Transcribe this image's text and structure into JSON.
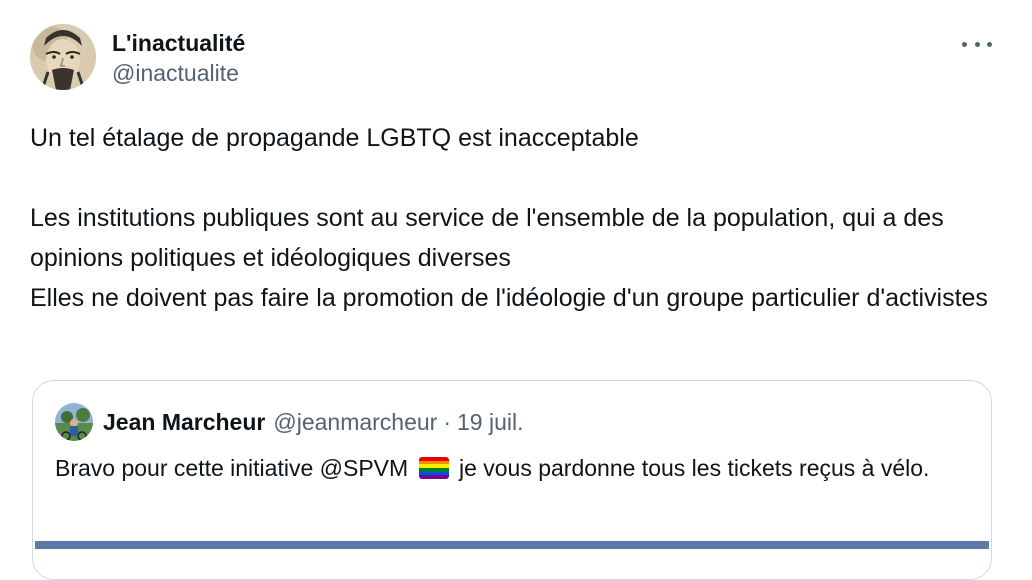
{
  "tweet": {
    "display_name": "L'inactualité",
    "handle": "@inactualite",
    "paragraphs": [
      "Un tel étalage de propagande LGBTQ est inacceptable",
      "Les institutions publiques sont au service de l'ensemble de la population, qui a des opinions politiques et idéologiques diverses",
      "Elles ne doivent pas faire la promotion de l'idéologie d'un groupe particulier d'activistes"
    ]
  },
  "quote": {
    "display_name": "Jean Marcheur",
    "handle": "@jeanmarcheur",
    "separator": "·",
    "date": "19 juil.",
    "text_before_flag": "Bravo pour cette initiative @SPVM",
    "text_after_flag": "je vous pardonne tous les tickets reçus à vélo."
  },
  "icons": {
    "more": "more-horizontal-icon",
    "flag": "rainbow-flag-icon"
  },
  "colors": {
    "text_primary": "#0f1419",
    "text_secondary": "#536471",
    "border": "#cfd9de"
  }
}
